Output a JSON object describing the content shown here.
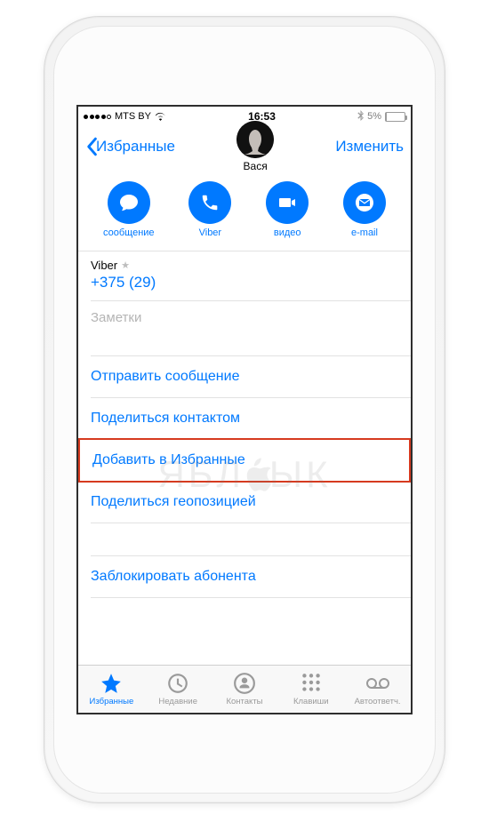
{
  "status": {
    "carrier": "MTS BY",
    "time": "16:53",
    "battery_text": "5%",
    "battery_pct": 5
  },
  "nav": {
    "back": "Избранные",
    "edit": "Изменить",
    "name": "Вася"
  },
  "actions": {
    "msg": "сообщение",
    "viber": "Viber",
    "video": "видео",
    "email": "e-mail"
  },
  "field": {
    "label": "Viber",
    "value": "+375 (29)"
  },
  "notes_placeholder": "Заметки",
  "links": {
    "send": "Отправить сообщение",
    "shareC": "Поделиться контактом",
    "fav": "Добавить в Избранные",
    "shareLoc": "Поделиться геопозицией",
    "block": "Заблокировать абонента"
  },
  "tabs": {
    "fav": "Избранные",
    "recent": "Недавние",
    "contacts": "Контакты",
    "keypad": "Клавиши",
    "vm": "Автоответч."
  },
  "watermark": {
    "left": "ЯБЛ",
    "right": "ЫК"
  }
}
